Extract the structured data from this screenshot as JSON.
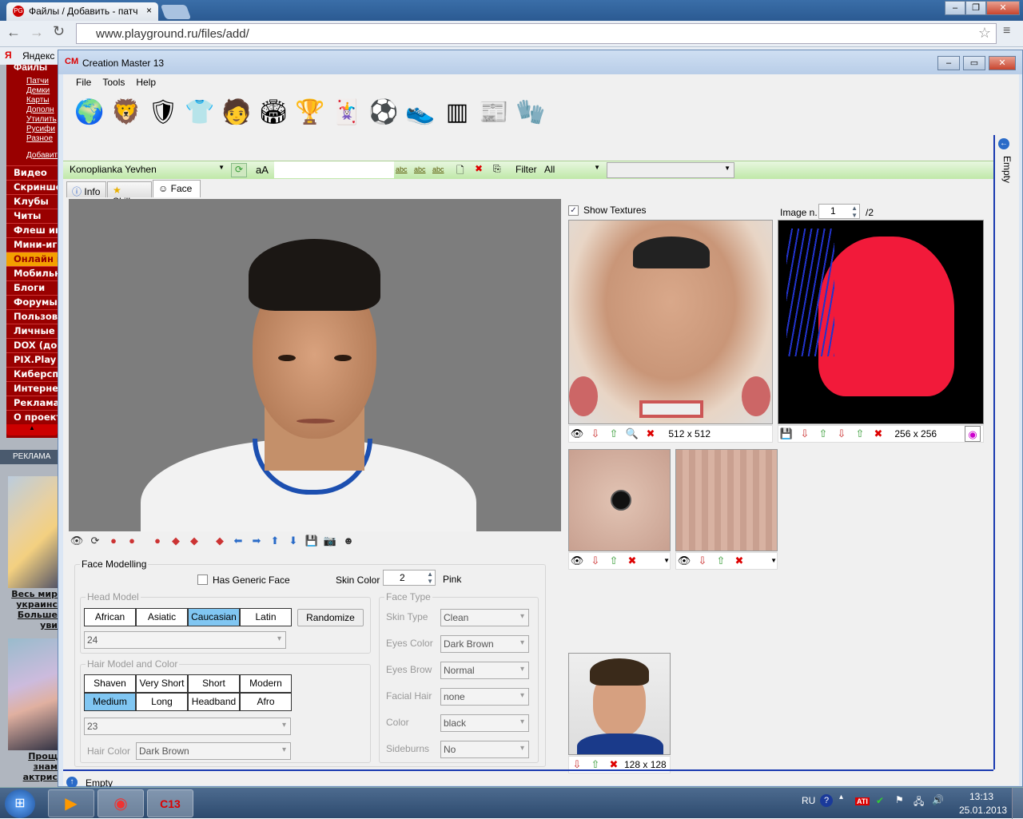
{
  "browser": {
    "tab_title": "Файлы / Добавить - патч",
    "tab_close": "×",
    "url": "www.playground.ru/files/add/",
    "bookmark": "Яндекс",
    "favicon": "PG"
  },
  "site_sidebar": {
    "heading": "Файлы",
    "subitems": [
      "Патчи",
      "Демки",
      "Карты",
      "Дополн",
      "Утилить",
      "Русифи",
      "Разное"
    ],
    "add_link": "Добавить",
    "items": [
      "Видео",
      "Скриншо",
      "Клубы",
      "Читы",
      "Флеш игр",
      "Мини-игр",
      "Онлайн и",
      "Мобильн",
      "Блоги",
      "Форумы",
      "Пользов",
      "Личные",
      "DOX (до",
      "PIX.Play",
      "Киберсп",
      "Интерне",
      "Реклама",
      "О проект"
    ],
    "highlighted_index": 6,
    "collapse": "▲",
    "ad_header": "РЕКЛАМА",
    "ad1_text": [
      "Весь мир",
      "украинс",
      "Больше",
      "уви"
    ],
    "ad2_text": [
      "Прощ",
      "знам",
      "актрис"
    ]
  },
  "app": {
    "title": "Creation Master 13",
    "logo": "CM",
    "menu": [
      "File",
      "Tools",
      "Help"
    ],
    "toolbar_icons": [
      "globe-icon",
      "premier-league-icon",
      "barcelona-icon",
      "arsenal-shirt-icon",
      "player-face-icon",
      "stadium-icon",
      "world-cup-icon",
      "cards-icon",
      "ball-icon",
      "boots-icon",
      "pitch-icon",
      "newspaper-icon",
      "gloves-icon"
    ],
    "player_select": "Konoplianka Yevhen",
    "case_label": "aA",
    "filter_label": "Filter",
    "filter_value": "All",
    "abc": "abc",
    "tabs": [
      "Info",
      "Skills",
      "Face"
    ],
    "active_tab": "Face",
    "side_strip": "Empty",
    "status": "Empty",
    "face_modelling": {
      "title": "Face Modelling",
      "has_generic_face": "Has Generic Face",
      "has_generic_checked": false,
      "skin_color_label": "Skin Color",
      "skin_color_value": "2",
      "skin_color_name": "Pink",
      "head_model": {
        "title": "Head Model",
        "options": [
          "African",
          "Asiatic",
          "Caucasian",
          "Latin"
        ],
        "selected": "Caucasian",
        "randomize": "Randomize",
        "model_number": "24"
      },
      "hair": {
        "title": "Hair Model and Color",
        "options": [
          "Shaven",
          "Very Short",
          "Short",
          "Modern",
          "Medium",
          "Long",
          "Headband",
          "Afro"
        ],
        "selected": "Medium",
        "model_number": "23",
        "hair_color_label": "Hair Color",
        "hair_color": "Dark Brown"
      },
      "face_type": {
        "title": "Face Type",
        "fields": [
          {
            "label": "Skin Type",
            "value": "Clean"
          },
          {
            "label": "Eyes Color",
            "value": "Dark Brown"
          },
          {
            "label": "Eyes Brow",
            "value": "Normal"
          },
          {
            "label": "Facial Hair",
            "value": "none"
          },
          {
            "label": "Color",
            "value": "black"
          },
          {
            "label": "Sideburns",
            "value": "No"
          }
        ]
      }
    },
    "textures": {
      "show_textures": "Show Textures",
      "show_checked": true,
      "image_n_label": "Image n.",
      "image_n": "1",
      "image_total": "/2",
      "face_size": "512 x 512",
      "hair_size": "256 x 256",
      "photo_size": "128 x 128"
    }
  },
  "taskbar": {
    "lang": "RU",
    "time": "13:13",
    "date": "25.01.2013"
  }
}
